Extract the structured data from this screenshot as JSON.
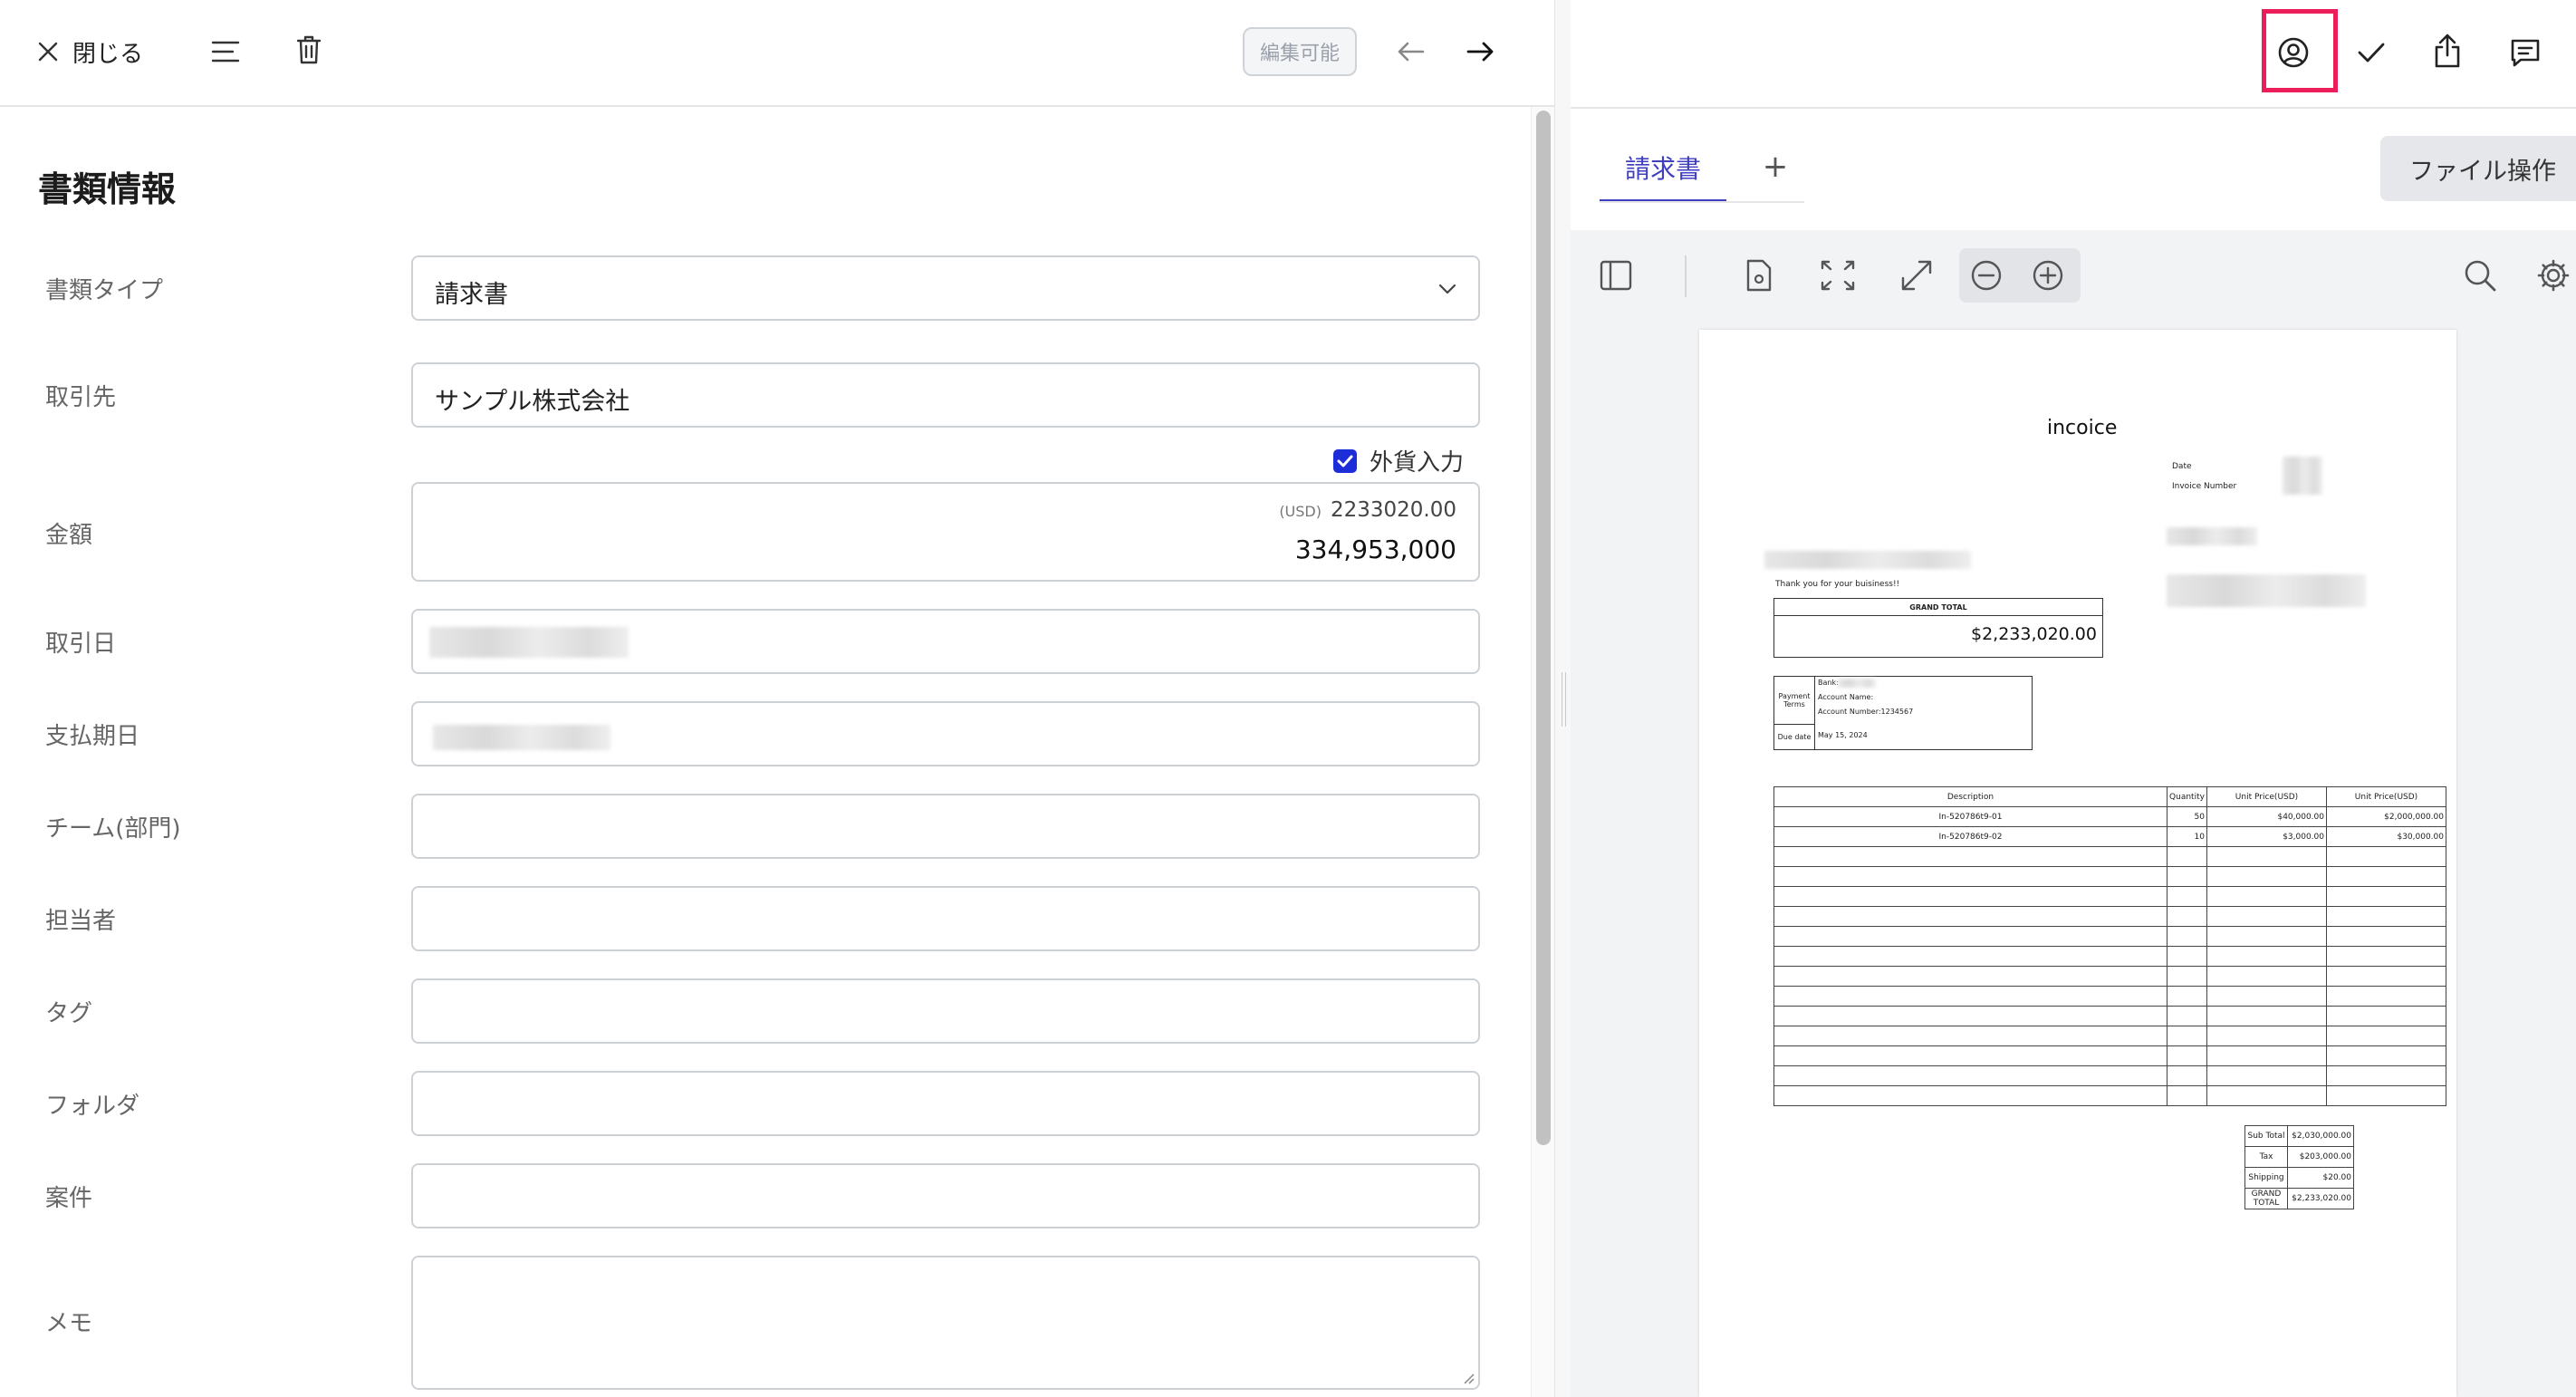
{
  "left_toolbar": {
    "close_label": "閉じる",
    "edit_badge": "編集可能"
  },
  "section_title": "書類情報",
  "fields": {
    "doc_type_label": "書類タイプ",
    "doc_type_value": "請求書",
    "partner_label": "取引先",
    "partner_value": "サンプル株式会社",
    "foreign_currency_label": "外貨入力",
    "foreign_currency_checked": true,
    "amount_label": "金額",
    "amount_currency": "(USD)",
    "amount_foreign": "2233020.00",
    "amount_jpy": "334,953,000",
    "trade_date_label": "取引日",
    "due_date_label": "支払期日",
    "team_label": "チーム(部門)",
    "assignee_label": "担当者",
    "tag_label": "タグ",
    "folder_label": "フォルダ",
    "project_label": "案件",
    "memo_label": "メモ"
  },
  "right_header": {
    "icons": [
      "user-circle-icon",
      "check-icon",
      "share-icon",
      "comment-icon"
    ],
    "highlight_color": "#ec1e5a"
  },
  "tabs": {
    "active_label": "請求書",
    "add_label": "+",
    "file_ops_label": "ファイル操作",
    "accent_color": "#3f3fc0"
  },
  "invoice": {
    "title": "incoice",
    "date_label": "Date",
    "invoice_number_label": "Invoice Number",
    "thanks": "Thank you for your buisiness!!",
    "grand_total_header": "GRAND TOTAL",
    "grand_total_value": "$2,233,020.00",
    "payment_terms_label": "Payment Terms",
    "bank_label": "Bank:",
    "account_name_label": "Account Name:",
    "account_number_label": "Account Number:1234567",
    "due_date_label": "Due date",
    "due_date_value": "May 15, 2024",
    "table_headers": [
      "Description",
      "Quantity",
      "Unit Price(USD)",
      "Unit Price(USD)"
    ],
    "rows": [
      [
        "In-520786t9-01",
        "50",
        "$40,000.00",
        "$2,000,000.00"
      ],
      [
        "In-520786t9-02",
        "10",
        "$3,000.00",
        "$30,000.00"
      ]
    ],
    "totals": [
      [
        "Sub Total",
        "$2,030,000.00"
      ],
      [
        "Tax",
        "$203,000.00"
      ],
      [
        "Shipping",
        "$20.00"
      ],
      [
        "GRAND TOTAL",
        "$2,233,020.00"
      ]
    ]
  }
}
